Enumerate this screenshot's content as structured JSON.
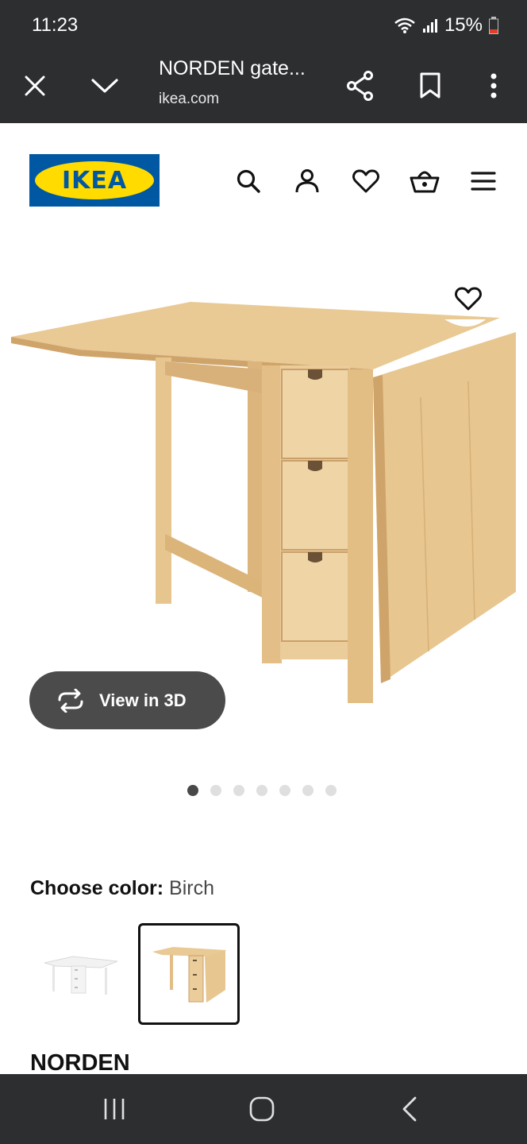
{
  "status_bar": {
    "time": "11:23",
    "battery": "15%"
  },
  "browser": {
    "page_title": "NORDEN gate...",
    "url": "ikea.com"
  },
  "site": {
    "logo_text": "IKEA"
  },
  "product": {
    "view_3d_label": "View in 3D",
    "carousel": {
      "count": 7,
      "active": 1
    },
    "color": {
      "label": "Choose color:",
      "value": "Birch"
    },
    "variants": [
      {
        "color": "white",
        "selected": false
      },
      {
        "color": "birch",
        "selected": true
      }
    ],
    "name": "NORDEN"
  },
  "colors": {
    "ikea_blue": "#0058a3",
    "ikea_yellow": "#ffdb00",
    "toolbar": "#2d2e30"
  }
}
